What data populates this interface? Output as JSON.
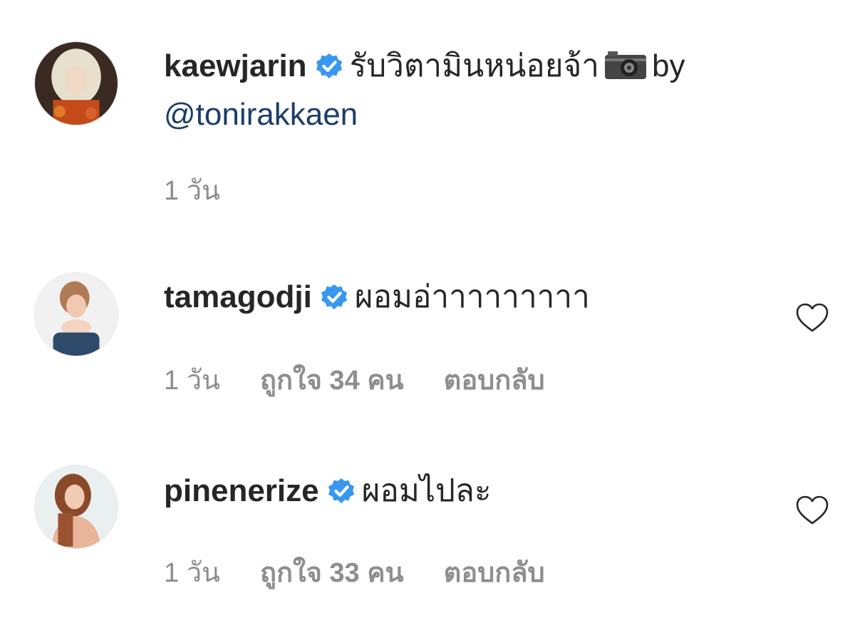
{
  "comments": [
    {
      "username": "kaewjarin",
      "text": "รับวิตามินหน่อยจ้า",
      "icon_after_text": "camera-icon",
      "text_after_icon": "by",
      "mention": "@tonirakkaen",
      "time": "1 วัน",
      "likes": "",
      "reply": "",
      "verified": true
    },
    {
      "username": "tamagodji",
      "text": "ผอมอ่าาาาาาาาา",
      "time": "1 วัน",
      "likes": "ถูกใจ 34 คน",
      "reply": "ตอบกลับ",
      "verified": true,
      "like_icon": "heart-icon"
    },
    {
      "username": "pinenerize",
      "text": "ผอมไปละ",
      "time": "1 วัน",
      "likes": "ถูกใจ 33 คน",
      "reply": "ตอบกลับ",
      "verified": true,
      "like_icon": "heart-icon"
    }
  ],
  "colors": {
    "text": "#262626",
    "meta": "#8e8e8e",
    "mention": "#1c3d6b",
    "verified": "#3897f0"
  }
}
